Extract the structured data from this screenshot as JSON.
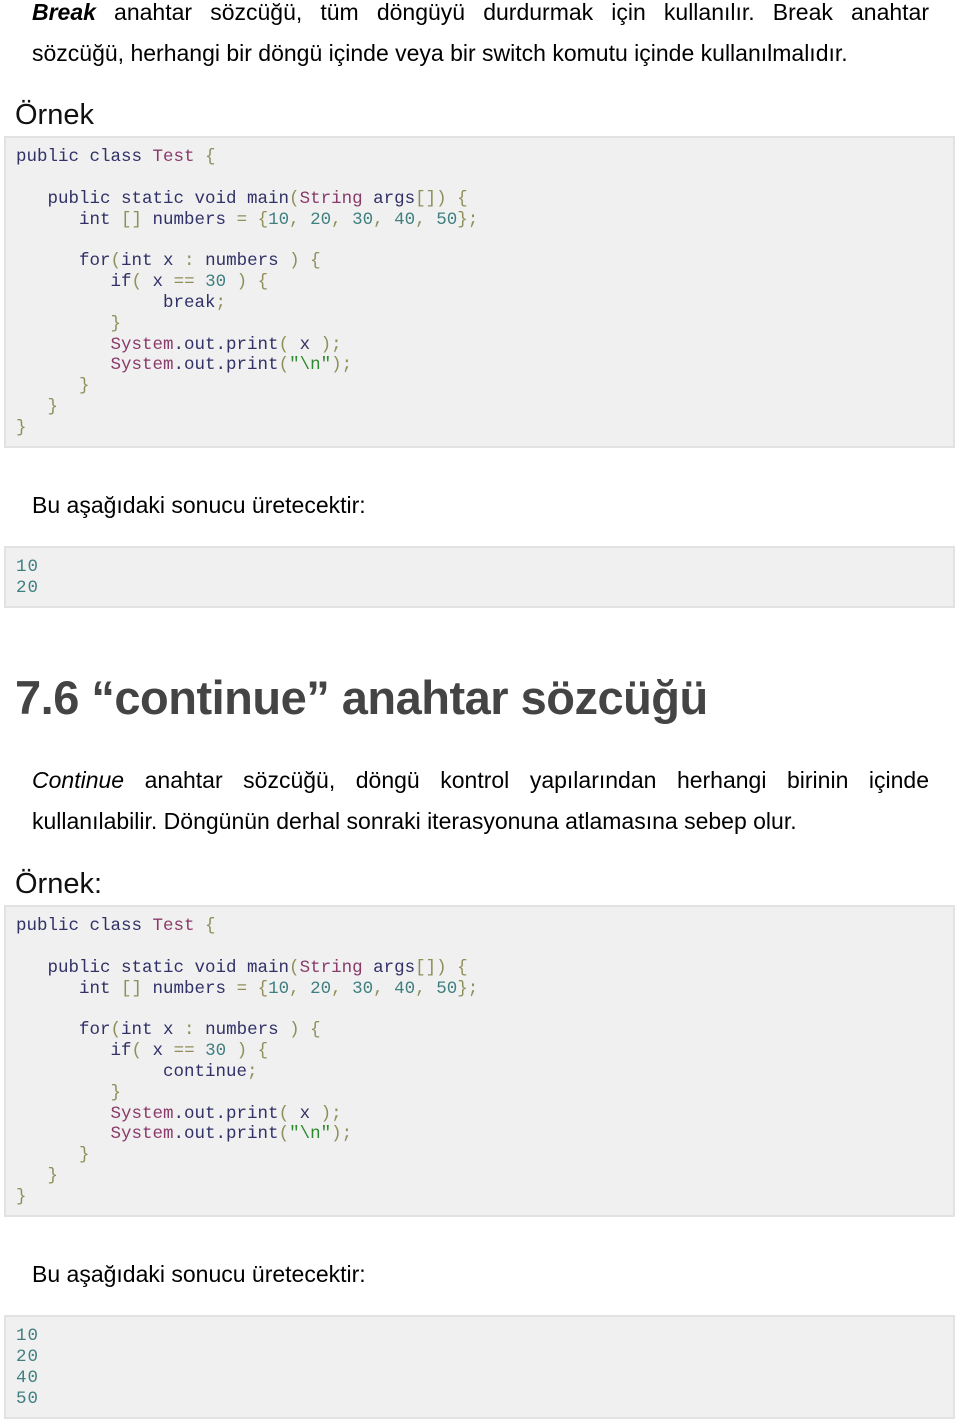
{
  "intro": {
    "bold_word": "Break",
    "line1_rest": " anahtar sözcüğü, tüm döngüyü durdurmak için kullanılır. Break anahtar",
    "line2": "sözcüğü, herhangi bir döngü içinde veya bir switch komutu içinde kullanılmalıdır."
  },
  "example1": {
    "label": "Örnek",
    "code": {
      "l1_kw": "public class ",
      "l1_cls": "Test",
      "l1_pun": " {",
      "l2_kw": "   public static void main",
      "l2_p1": "(",
      "l2_cls": "String",
      "l2_kw2": " args",
      "l2_p2": "[]) {",
      "l3_kw": "      int ",
      "l3_p1": "[]",
      "l3_kw2": " numbers ",
      "l3_p2": "= {",
      "nums": [
        "10",
        "20",
        "30",
        "40",
        "50"
      ],
      "l3_end": "};",
      "l4_kw": "      for",
      "l4_p1": "(",
      "l4_kw2": "int x ",
      "l4_p2": ":",
      "l4_kw3": " numbers ",
      "l4_p3": ") {",
      "l5_kw": "         if",
      "l5_p1": "( ",
      "l5_kw2": "x ",
      "l5_p2": "== ",
      "l5_num": "30",
      "l5_p3": " ) {",
      "l6_kw": "              break",
      "l6_p": ";",
      "l7_p": "         }",
      "l8_cls": "         System",
      "l8_kw": ".out.print",
      "l8_p1": "( ",
      "l8_kw2": "x ",
      "l8_p2": ");",
      "l9_cls": "         System",
      "l9_kw": ".out.print",
      "l9_p1": "(",
      "l9_str": "\"\\n\"",
      "l9_p2": ");",
      "l10_p": "      }",
      "l11_p": "   }",
      "l12_p": "}"
    },
    "result_label": "Bu aşağıdaki sonucu üretecektir:",
    "output": [
      "10",
      "20"
    ]
  },
  "section": {
    "heading": "7.6 “continue” anahtar sözcüğü",
    "italic_word": "Continue",
    "line1_rest": " anahtar sözcüğü, döngü kontrol yapılarından herhangi birinin içinde",
    "line2": "kullanılabilir. Döngünün derhal sonraki iterasyonuna atlamasına sebep olur."
  },
  "example2": {
    "label": "Örnek:",
    "l6_kw": "              continue",
    "result_label": "Bu aşağıdaki sonucu üretecektir:",
    "output": [
      "10",
      "20",
      "40",
      "50"
    ]
  },
  "colors": {
    "code_bg": "#f0f0f0",
    "code_border": "#e2e2e2",
    "keyword": "#313167",
    "class_name": "#8a3a6a",
    "punctuation": "#8f8f5a",
    "number": "#3f7f7f",
    "string": "#2d8a2d",
    "heading": "#444444"
  }
}
